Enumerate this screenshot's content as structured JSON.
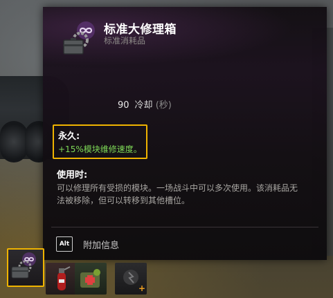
{
  "item": {
    "title": "标准大修理箱",
    "subtitle": "标准消耗品",
    "icon": "repair-kit-icon"
  },
  "stats": {
    "cooldown_value": "90",
    "cooldown_label": "冷却",
    "cooldown_unit": "(秒)"
  },
  "permanent": {
    "label": "永久:",
    "value": "+15%模块维修速度。"
  },
  "on_use": {
    "label": "使用时:",
    "description": "可以修理所有受损的模块。一场战斗中可以多次使用。该消耗品无法被移除，但可以转移到其他槽位。"
  },
  "footer": {
    "key": "Alt",
    "text": "附加信息"
  },
  "slots": [
    {
      "icon": "repair-kit-icon",
      "selected": true
    },
    {
      "icon": "fire-extinguisher-icon",
      "selected": false
    },
    {
      "icon": "first-aid-kit-icon",
      "selected": false
    },
    {
      "icon": "empty-slot-icon",
      "selected": false,
      "badge": "+"
    }
  ],
  "colors": {
    "highlight": "#f0b400",
    "bonus": "#7ed957",
    "accent": "#9b59b6"
  }
}
